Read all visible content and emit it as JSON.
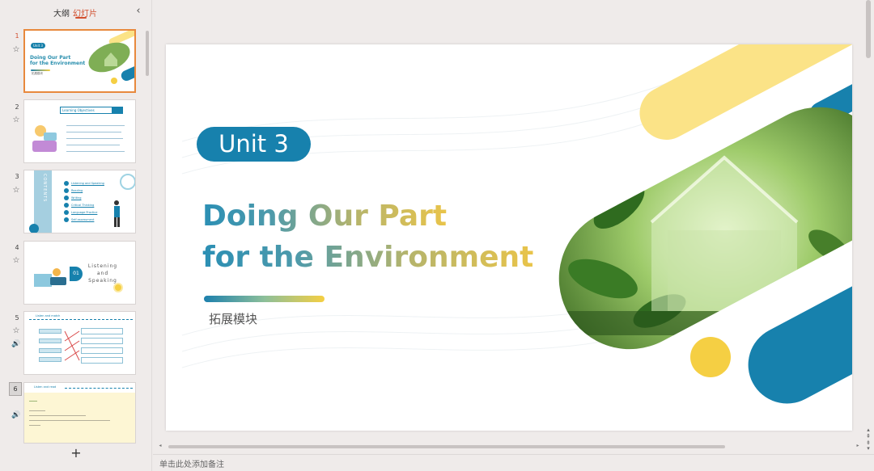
{
  "left_panel": {
    "tab_outline": "大纲",
    "tab_slides": "幻灯片",
    "collapse_icon": "chevron-left-icon",
    "add_slide": "+",
    "thumbnails": [
      {
        "num": "1",
        "pill": "Unit 3",
        "title1": "Doing Our Part",
        "title2": "for the Environment",
        "sub": "拓展模块"
      },
      {
        "num": "2",
        "header": "Learning Objectives"
      },
      {
        "num": "3",
        "side": "CONTENTS",
        "items": [
          "Listening and Speaking",
          "Reading",
          "Writing",
          "Critical Thinking",
          "Language Practice",
          "Self-assessment"
        ]
      },
      {
        "num": "4",
        "label": "Listening and Speaking",
        "section_no": "01"
      },
      {
        "num": "5",
        "header": "Listen and match"
      },
      {
        "num": "6",
        "header": "Listen and read"
      }
    ]
  },
  "slide": {
    "unit": "Unit 3",
    "title_line1": "Doing Our Part",
    "title_line2": "for the Environment",
    "subtitle": "拓展模块"
  },
  "notes": {
    "placeholder": "单击此处添加备注"
  },
  "colors": {
    "accent_blue": "#1781ad",
    "accent_yellow": "#f5cf43",
    "light_yellow": "#fbe387",
    "active_orange": "#e8893d"
  }
}
